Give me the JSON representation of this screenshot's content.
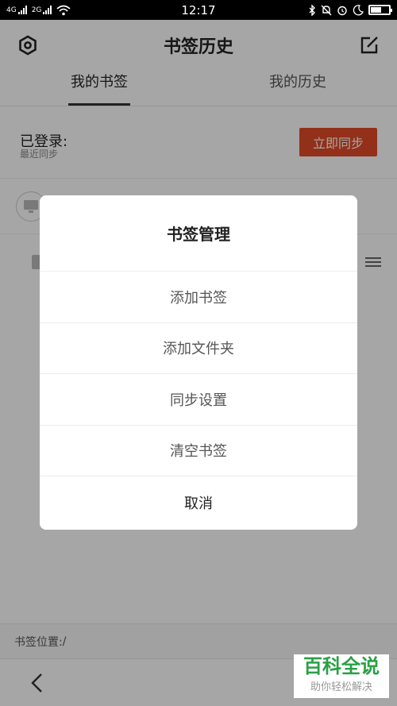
{
  "status_bar": {
    "time": "12:17",
    "net1": "4G",
    "net2": "2G"
  },
  "header": {
    "title": "书签历史"
  },
  "tabs": [
    {
      "label": "我的书签"
    },
    {
      "label": "我的历史"
    }
  ],
  "account": {
    "logged_in_label": "已登录:",
    "last_sync_label": "最近同步",
    "sync_button": "立即同步"
  },
  "footer": {
    "bookmark_location_label": "书签位置:",
    "bookmark_location_value": "/"
  },
  "dialog": {
    "title": "书签管理",
    "items": [
      {
        "label": "添加书签"
      },
      {
        "label": "添加文件夹"
      },
      {
        "label": "同步设置"
      },
      {
        "label": "清空书签"
      }
    ],
    "cancel": "取消"
  },
  "watermark": {
    "title": "百科全说",
    "subtitle": "助你轻松解决"
  },
  "colors": {
    "accent": "#e04b27",
    "watermark_green": "#2aa046"
  }
}
